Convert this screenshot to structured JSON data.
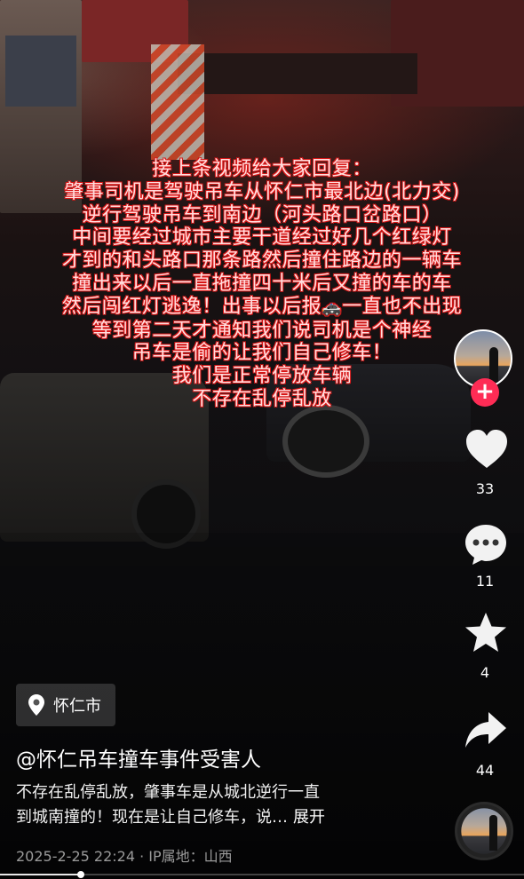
{
  "overlay_lines": [
    "接上条视频给大家回复：",
    "肇事司机是驾驶吊车从怀仁市最北边(北力交)",
    "逆行驾驶吊车到南边（河头路口岔路口）",
    "中间要经过城市主要干道经过好几个红绿灯",
    "才到的和头路口那条路然后撞住路边的一辆车",
    "撞出来以后一直拖撞四十米后又撞的车的车",
    "然后闯红灯逃逸！出事以后报",
    "一直也不出现",
    "等到第二天才通知我们说司机是个神经",
    "吊车是偷的让我们自己修车！",
    "我们是正常停放车辆",
    "不存在乱停乱放"
  ],
  "overlay_emoji": "🚓",
  "actions": {
    "like_count": "33",
    "comment_count": "11",
    "favorite_count": "4",
    "share_count": "44",
    "follow_symbol": "+"
  },
  "location": {
    "label": "怀仁市",
    "icon": "location-pin-icon"
  },
  "author": "@怀仁吊车撞车事件受害人",
  "description": {
    "text_line1": "不存在乱停乱放，肇事车是从城北逆行一直",
    "text_line2": "到城南撞的！现在是让自己修车，说…",
    "expand_label": "展开"
  },
  "meta": "2025-2-25 22:24 · IP属地：山西",
  "progress": {
    "fraction": 0.155
  },
  "colors": {
    "accent": "#fe2c55",
    "overlay_text": "#d51616"
  }
}
